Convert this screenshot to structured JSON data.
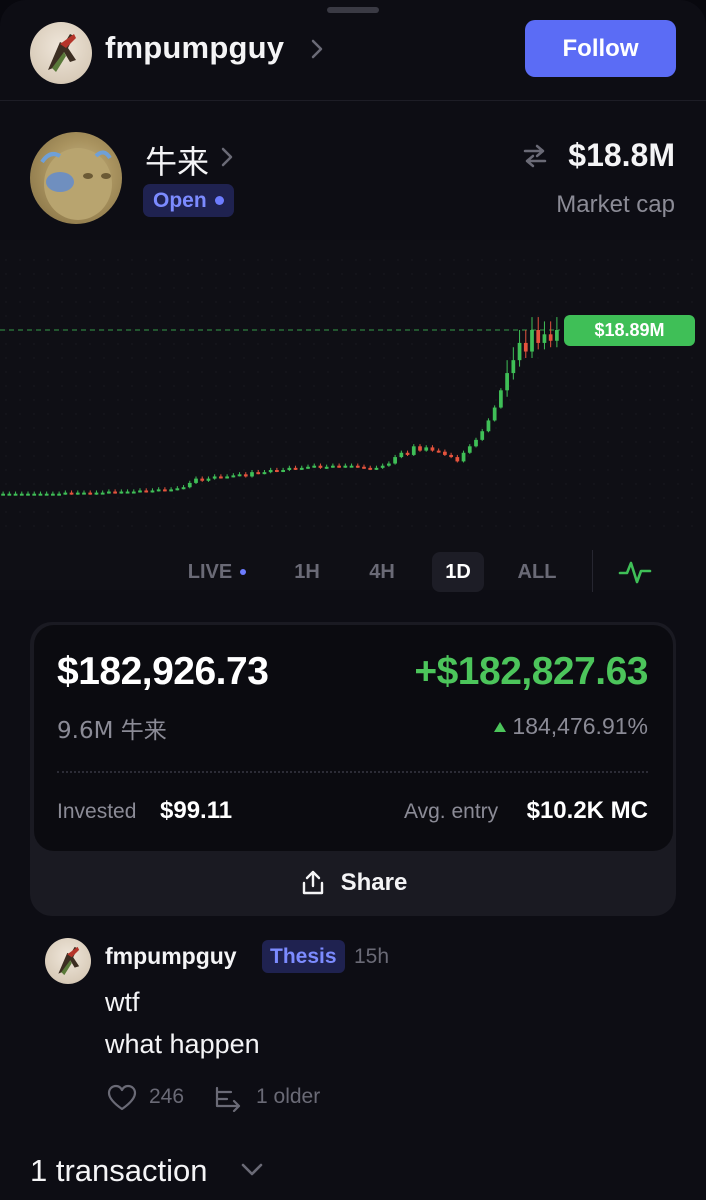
{
  "header": {
    "username": "fmpumpguy",
    "follow_label": "Follow"
  },
  "token": {
    "name": "牛来",
    "status": "Open",
    "market_cap": "$18.8M",
    "market_cap_label": "Market cap"
  },
  "chart_data": {
    "type": "candlestick",
    "title": "",
    "current_price_label": "$18.89M",
    "timeframe": "1D",
    "candles": [
      {
        "o": 0.02,
        "c": 0.02
      },
      {
        "o": 0.02,
        "c": 0.02
      },
      {
        "o": 0.02,
        "c": 0.02
      },
      {
        "o": 0.02,
        "c": 0.02
      },
      {
        "o": 0.02,
        "c": 0.02
      },
      {
        "o": 0.02,
        "c": 0.02
      },
      {
        "o": 0.02,
        "c": 0.02
      },
      {
        "o": 0.02,
        "c": 0.02
      },
      {
        "o": 0.02,
        "c": 0.02
      },
      {
        "o": 0.02,
        "c": 0.02
      },
      {
        "o": 0.02,
        "c": 0.025
      },
      {
        "o": 0.025,
        "c": 0.02
      },
      {
        "o": 0.02,
        "c": 0.025
      },
      {
        "o": 0.025,
        "c": 0.025
      },
      {
        "o": 0.025,
        "c": 0.02
      },
      {
        "o": 0.02,
        "c": 0.025
      },
      {
        "o": 0.025,
        "c": 0.025
      },
      {
        "o": 0.025,
        "c": 0.03
      },
      {
        "o": 0.03,
        "c": 0.025
      },
      {
        "o": 0.025,
        "c": 0.03
      },
      {
        "o": 0.03,
        "c": 0.03
      },
      {
        "o": 0.03,
        "c": 0.03
      },
      {
        "o": 0.03,
        "c": 0.035
      },
      {
        "o": 0.035,
        "c": 0.03
      },
      {
        "o": 0.03,
        "c": 0.035
      },
      {
        "o": 0.035,
        "c": 0.04
      },
      {
        "o": 0.04,
        "c": 0.035
      },
      {
        "o": 0.035,
        "c": 0.04
      },
      {
        "o": 0.04,
        "c": 0.045
      },
      {
        "o": 0.045,
        "c": 0.05
      },
      {
        "o": 0.05,
        "c": 0.07
      },
      {
        "o": 0.07,
        "c": 0.09
      },
      {
        "o": 0.09,
        "c": 0.08
      },
      {
        "o": 0.08,
        "c": 0.09
      },
      {
        "o": 0.09,
        "c": 0.1
      },
      {
        "o": 0.1,
        "c": 0.095
      },
      {
        "o": 0.095,
        "c": 0.1
      },
      {
        "o": 0.1,
        "c": 0.105
      },
      {
        "o": 0.105,
        "c": 0.11
      },
      {
        "o": 0.11,
        "c": 0.1
      },
      {
        "o": 0.1,
        "c": 0.12
      },
      {
        "o": 0.12,
        "c": 0.115
      },
      {
        "o": 0.115,
        "c": 0.12
      },
      {
        "o": 0.12,
        "c": 0.13
      },
      {
        "o": 0.13,
        "c": 0.125
      },
      {
        "o": 0.125,
        "c": 0.13
      },
      {
        "o": 0.13,
        "c": 0.14
      },
      {
        "o": 0.14,
        "c": 0.135
      },
      {
        "o": 0.135,
        "c": 0.14
      },
      {
        "o": 0.14,
        "c": 0.145
      },
      {
        "o": 0.145,
        "c": 0.15
      },
      {
        "o": 0.15,
        "c": 0.14
      },
      {
        "o": 0.14,
        "c": 0.145
      },
      {
        "o": 0.145,
        "c": 0.15
      },
      {
        "o": 0.15,
        "c": 0.145
      },
      {
        "o": 0.145,
        "c": 0.15
      },
      {
        "o": 0.15,
        "c": 0.15
      },
      {
        "o": 0.15,
        "c": 0.145
      },
      {
        "o": 0.145,
        "c": 0.14
      },
      {
        "o": 0.14,
        "c": 0.135
      },
      {
        "o": 0.135,
        "c": 0.14
      },
      {
        "o": 0.14,
        "c": 0.15
      },
      {
        "o": 0.15,
        "c": 0.16
      },
      {
        "o": 0.16,
        "c": 0.19
      },
      {
        "o": 0.19,
        "c": 0.21
      },
      {
        "o": 0.21,
        "c": 0.2
      },
      {
        "o": 0.2,
        "c": 0.24
      },
      {
        "o": 0.24,
        "c": 0.22
      },
      {
        "o": 0.22,
        "c": 0.235
      },
      {
        "o": 0.235,
        "c": 0.22
      },
      {
        "o": 0.22,
        "c": 0.215
      },
      {
        "o": 0.215,
        "c": 0.2
      },
      {
        "o": 0.2,
        "c": 0.19
      },
      {
        "o": 0.19,
        "c": 0.17
      },
      {
        "o": 0.17,
        "c": 0.21
      },
      {
        "o": 0.21,
        "c": 0.24
      },
      {
        "o": 0.24,
        "c": 0.27
      },
      {
        "o": 0.27,
        "c": 0.31
      },
      {
        "o": 0.31,
        "c": 0.36
      },
      {
        "o": 0.36,
        "c": 0.42
      },
      {
        "o": 0.42,
        "c": 0.5
      },
      {
        "o": 0.5,
        "c": 0.58
      },
      {
        "o": 0.58,
        "c": 0.64
      },
      {
        "o": 0.64,
        "c": 0.72
      },
      {
        "o": 0.72,
        "c": 0.68
      },
      {
        "o": 0.68,
        "c": 0.78
      },
      {
        "o": 0.78,
        "c": 0.72
      },
      {
        "o": 0.72,
        "c": 0.76
      },
      {
        "o": 0.76,
        "c": 0.73
      },
      {
        "o": 0.73,
        "c": 0.78
      }
    ]
  },
  "timeframes": [
    "LIVE",
    "1H",
    "4H",
    "1D",
    "ALL"
  ],
  "position": {
    "value": "$182,926.73",
    "pnl": "+$182,827.63",
    "quantity": "9.6M 牛来",
    "pct": "184,476.91%",
    "invested_label": "Invested",
    "invested_value": "$99.11",
    "avg_label": "Avg. entry",
    "avg_value": "$10.2K MC",
    "share_label": "Share"
  },
  "comment": {
    "user": "fmpumpguy",
    "tag": "Thesis",
    "time": "15h",
    "line1": "wtf",
    "line2": "what happen",
    "likes": "246",
    "older": "1 older"
  },
  "transactions": {
    "title": "1 transaction"
  },
  "colors": {
    "accent": "#5b6cf5",
    "up": "#3fbf57",
    "down": "#e5533d"
  }
}
